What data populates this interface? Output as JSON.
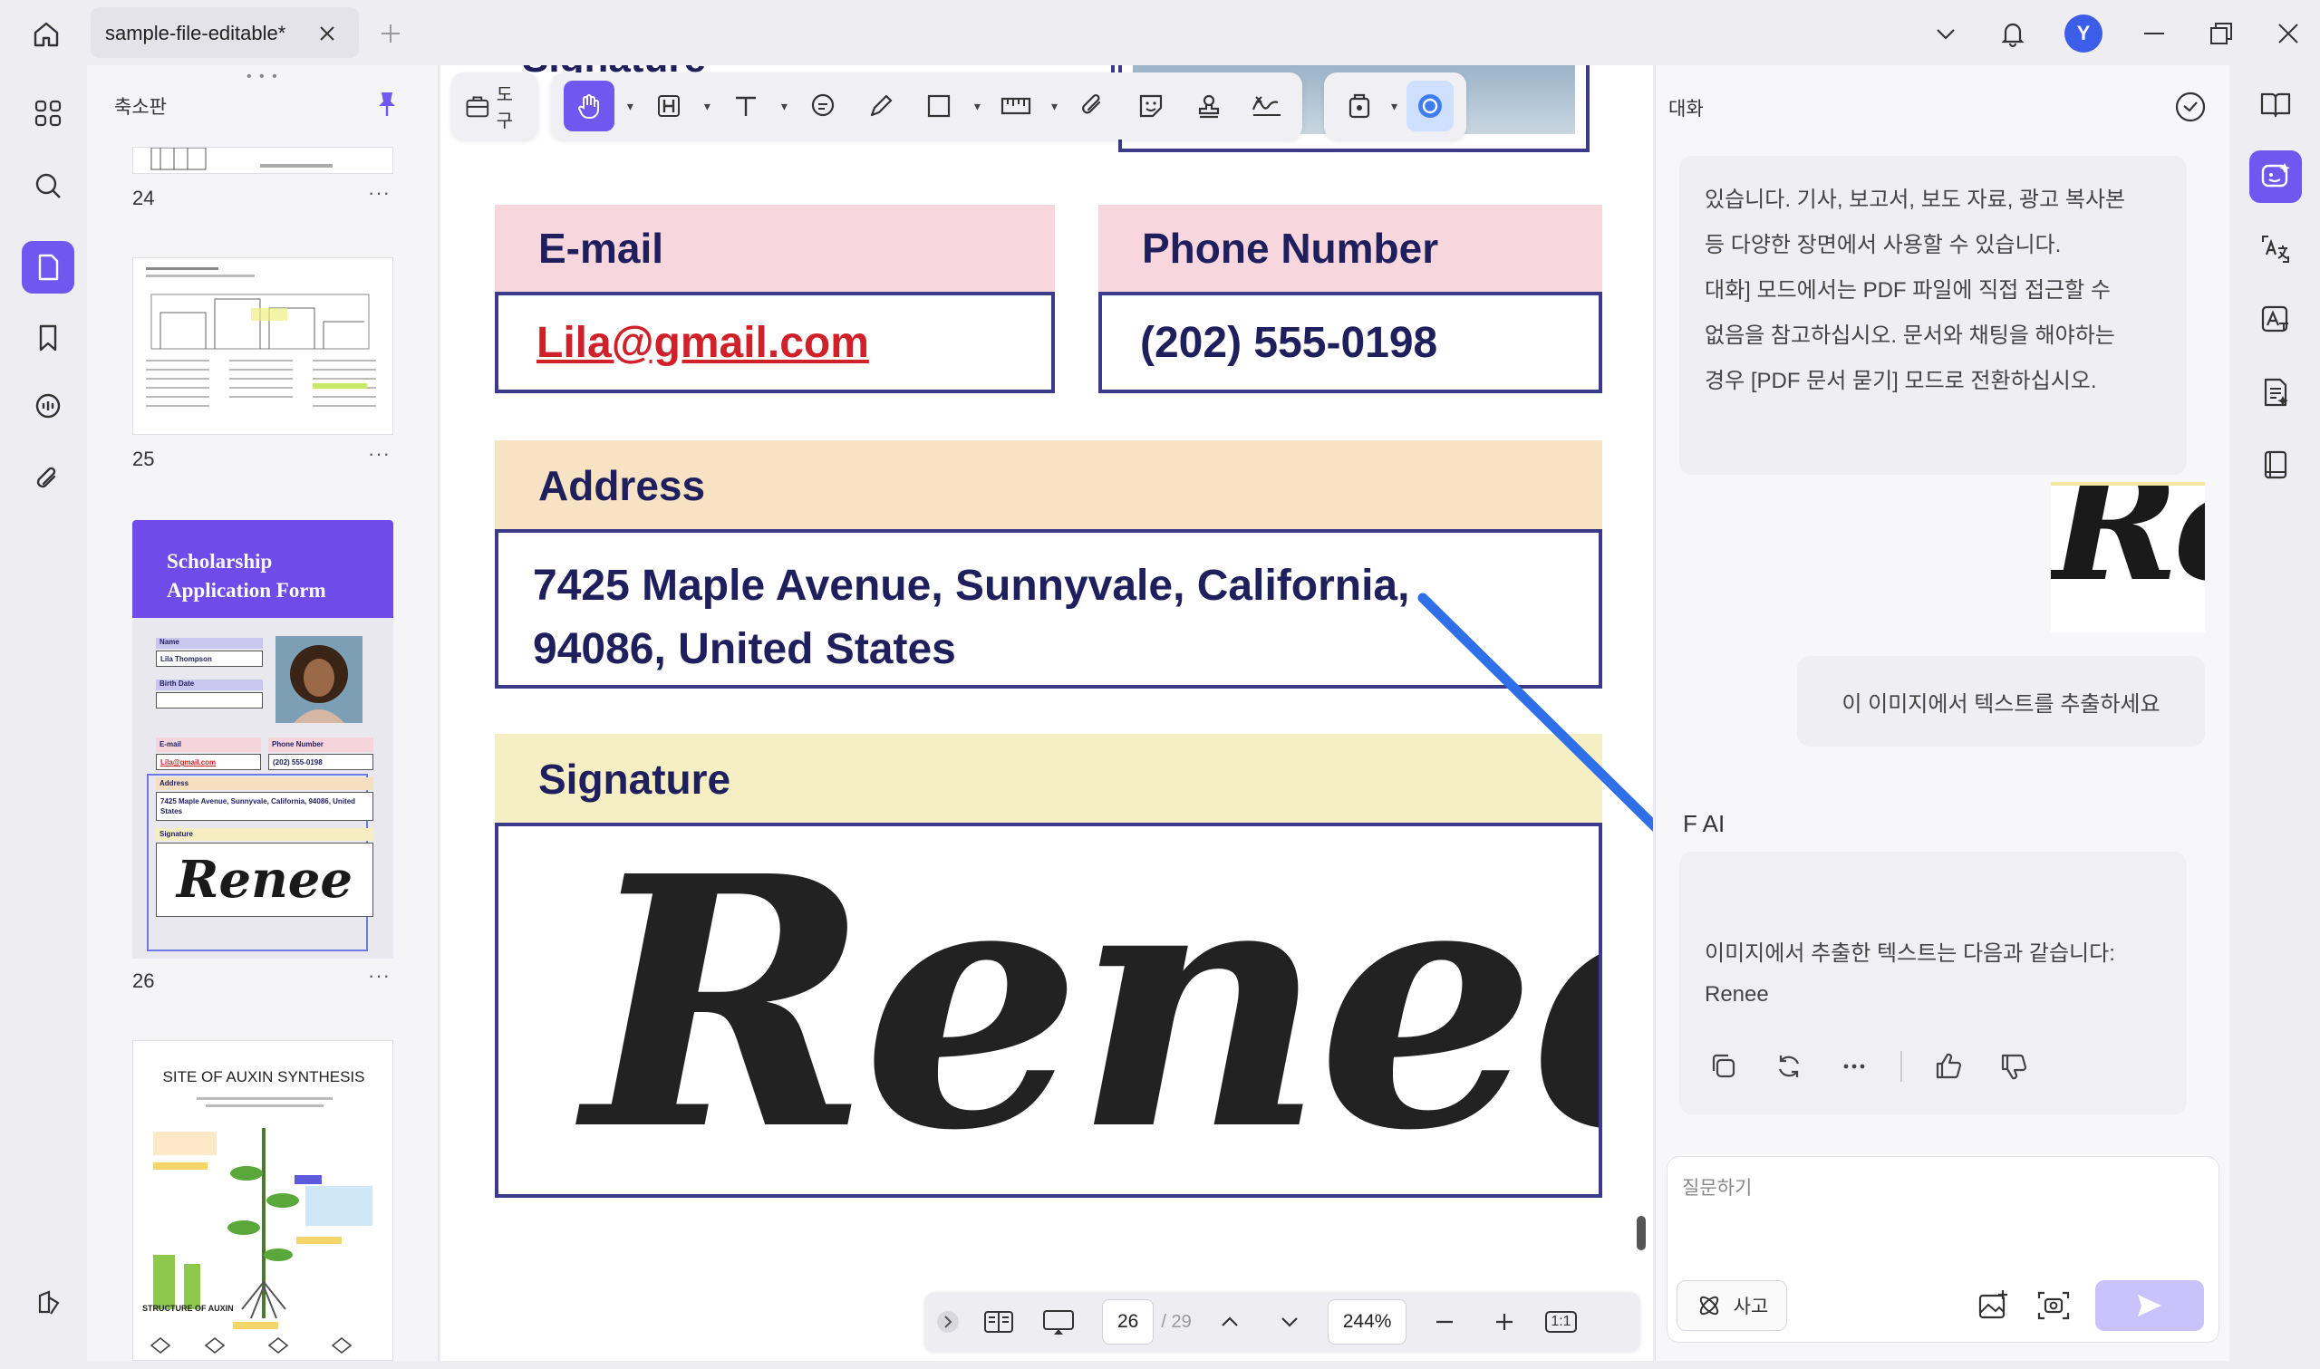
{
  "titlebar": {
    "tab_title": "sample-file-editable*",
    "avatar_letter": "Y"
  },
  "thumbnails": {
    "title": "축소판",
    "pages": [
      {
        "num": "24",
        "more": "···"
      },
      {
        "num": "25",
        "more": "···"
      },
      {
        "num": "26",
        "more": "···"
      },
      {
        "num": "",
        "more": ""
      }
    ],
    "page26": {
      "header": "Scholarship\nApplication Form",
      "name_label": "Name",
      "name_value": "Lila Thompson",
      "birth_label": "Birth Date",
      "email_label": "E-mail",
      "email_value": "Lila@gmail.com",
      "phone_label": "Phone Number",
      "phone_value": "(202) 555-0198",
      "address_label": "Address",
      "address_value": "7425 Maple Avenue, Sunnyvale, California, 94086, United States",
      "signature_label": "Signature",
      "signature_value": "Renee"
    },
    "page27": {
      "title": "SITE OF AUXIN SYNTHESIS",
      "footer": "STRUCTURE OF AUXIN"
    }
  },
  "toolbar": {
    "tools_label": "도구"
  },
  "document": {
    "top_partial_text": "Signature",
    "email_label": "E-mail",
    "email_value": "Lila@gmail.com",
    "phone_label": "Phone Number",
    "phone_value": "(202) 555-0198",
    "address_label": "Address",
    "address_line1": "7425 Maple Avenue, Sunnyvale, California,",
    "address_line2": "94086, United States",
    "signature_label": "Signature",
    "signature_value": "Renee"
  },
  "bottom_bar": {
    "current_page": "26",
    "total_pages": "/ 29",
    "zoom": "244%",
    "fit_label": "1:1"
  },
  "chat": {
    "title": "대화",
    "ai_message_1": "있습니다. 기사, 보고서, 보도 자료, 광고 복사본\n등 다양한 장면에서 사용할 수 있습니다.\n대화] 모드에서는 PDF 파일에 직접 접근할 수\n없음을 참고하십시오. 문서와 채팅을 해야하는\n경우 [PDF 문서 묻기] 모드로 전환하십시오.",
    "image_text": "Ren",
    "user_message": "이 이미지에서 텍스트를 추출하세요",
    "ai_label": "F AI",
    "ai_message_2_line1": "이미지에서 추출한 텍스트는 다음과 같습니다:",
    "ai_message_2_line2": "Renee",
    "input_placeholder": "질문하기",
    "think_label": "사고"
  },
  "colors": {
    "accent": "#6f57f0",
    "email_header": "#f7d6de",
    "address_header": "#f8e2c4",
    "signature_header": "#f7efc4",
    "field_border": "#3c3a8a",
    "link_red": "#d0202a",
    "arrow_blue": "#2f6fe8"
  }
}
